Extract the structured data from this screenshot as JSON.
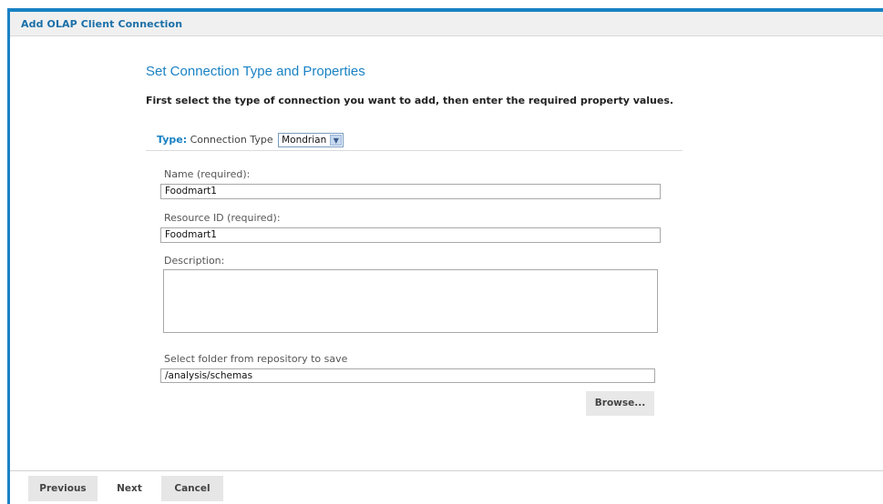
{
  "window": {
    "title": "Add OLAP Client Connection"
  },
  "header": {
    "heading": "Set Connection Type and Properties",
    "instructions": "First select the type of connection you want to add, then enter the required property values."
  },
  "type_row": {
    "label": "Type:",
    "sublabel": "Connection Type",
    "selected": "Mondrian"
  },
  "fields": {
    "name_label": "Name (required):",
    "name_value": "Foodmart1",
    "resource_label": "Resource ID (required):",
    "resource_value": "Foodmart1",
    "description_label": "Description:",
    "description_value": "",
    "folder_label": "Select folder from repository to save",
    "folder_value": "/analysis/schemas"
  },
  "buttons": {
    "browse": "Browse...",
    "previous": "Previous",
    "next": "Next",
    "cancel": "Cancel"
  },
  "colors": {
    "accent": "#1a82c4",
    "title_text": "#1a6fa8",
    "button_bg": "#e6e6e6"
  }
}
